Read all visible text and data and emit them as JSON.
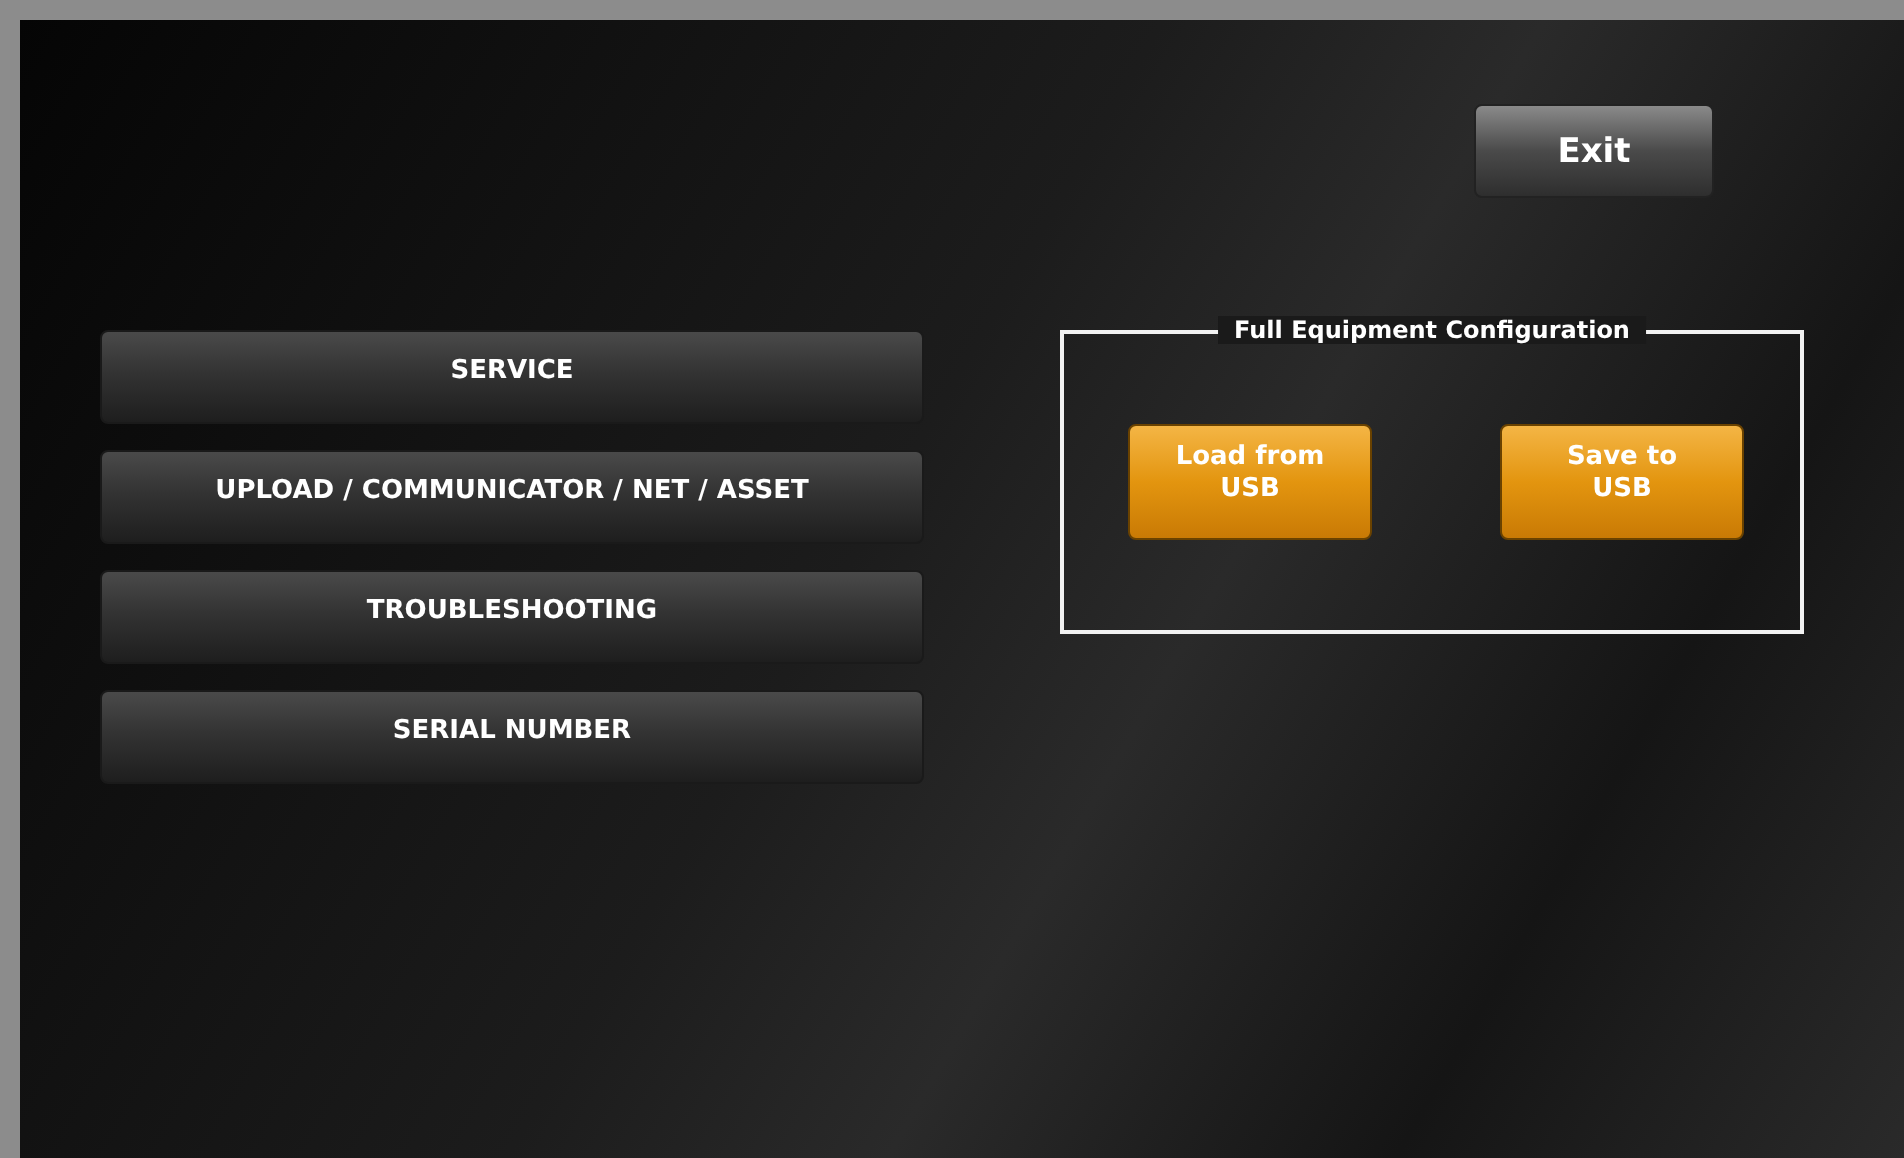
{
  "exit_button": "Exit",
  "menu_buttons": [
    "SERVICE",
    "UPLOAD / COMMUNICATOR / NET / ASSET",
    "TROUBLESHOOTING",
    "SERIAL NUMBER"
  ],
  "config_group": {
    "title": "Full Equipment Configuration",
    "buttons": [
      "Load from USB",
      "Save to USB"
    ]
  }
}
